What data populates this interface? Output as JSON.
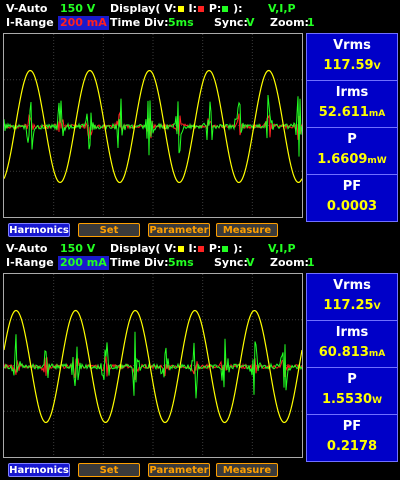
{
  "colors": {
    "voltage": "#ffff00",
    "current": "#ff2222",
    "power": "#22ff22",
    "measure_bg": "#0000c8",
    "button_accent": "#ffa000"
  },
  "panels": [
    {
      "v_auto_label": "V-Auto",
      "v_auto_value": "150  V",
      "display_label": "Display(",
      "display_v": "V:",
      "display_i": "I:",
      "display_p": "P:",
      "display_close": "):",
      "display_value": "V,I,P",
      "i_range_label": "I-Range",
      "i_range_value": "200  mA",
      "time_div_label": "Time  Div:",
      "time_div_value": "5ms",
      "sync_label": "Sync:",
      "sync_value": "V",
      "zoom_label": "Zoom:",
      "zoom_value": "1",
      "measurements": [
        {
          "label": "Vrms",
          "value": "117.59",
          "unit": "V"
        },
        {
          "label": "Irms",
          "value": "52.611",
          "unit": "mA"
        },
        {
          "label": "P",
          "value": "1.6609",
          "unit": "mW"
        },
        {
          "label": "PF",
          "value": "0.0003",
          "unit": ""
        }
      ],
      "buttons": [
        "Harmonics",
        "Set",
        "Parameter",
        "Measure"
      ]
    },
    {
      "v_auto_label": "V-Auto",
      "v_auto_value": "150  V",
      "display_label": "Display(",
      "display_v": "V:",
      "display_i": "I:",
      "display_p": "P:",
      "display_close": "):",
      "display_value": "V,I,P",
      "i_range_label": "I-Range",
      "i_range_value": "200  mA",
      "time_div_label": "Time  Div:",
      "time_div_value": "5ms",
      "sync_label": "Sync:",
      "sync_value": "V",
      "zoom_label": "Zoom:",
      "zoom_value": "1",
      "measurements": [
        {
          "label": "Vrms",
          "value": "117.25",
          "unit": "V"
        },
        {
          "label": "Irms",
          "value": "60.813",
          "unit": "mA"
        },
        {
          "label": "P",
          "value": "1.5530",
          "unit": "W"
        },
        {
          "label": "PF",
          "value": "0.2178",
          "unit": ""
        }
      ],
      "buttons": [
        "Harmonics",
        "Set",
        "Parameter",
        "Measure"
      ]
    }
  ]
}
